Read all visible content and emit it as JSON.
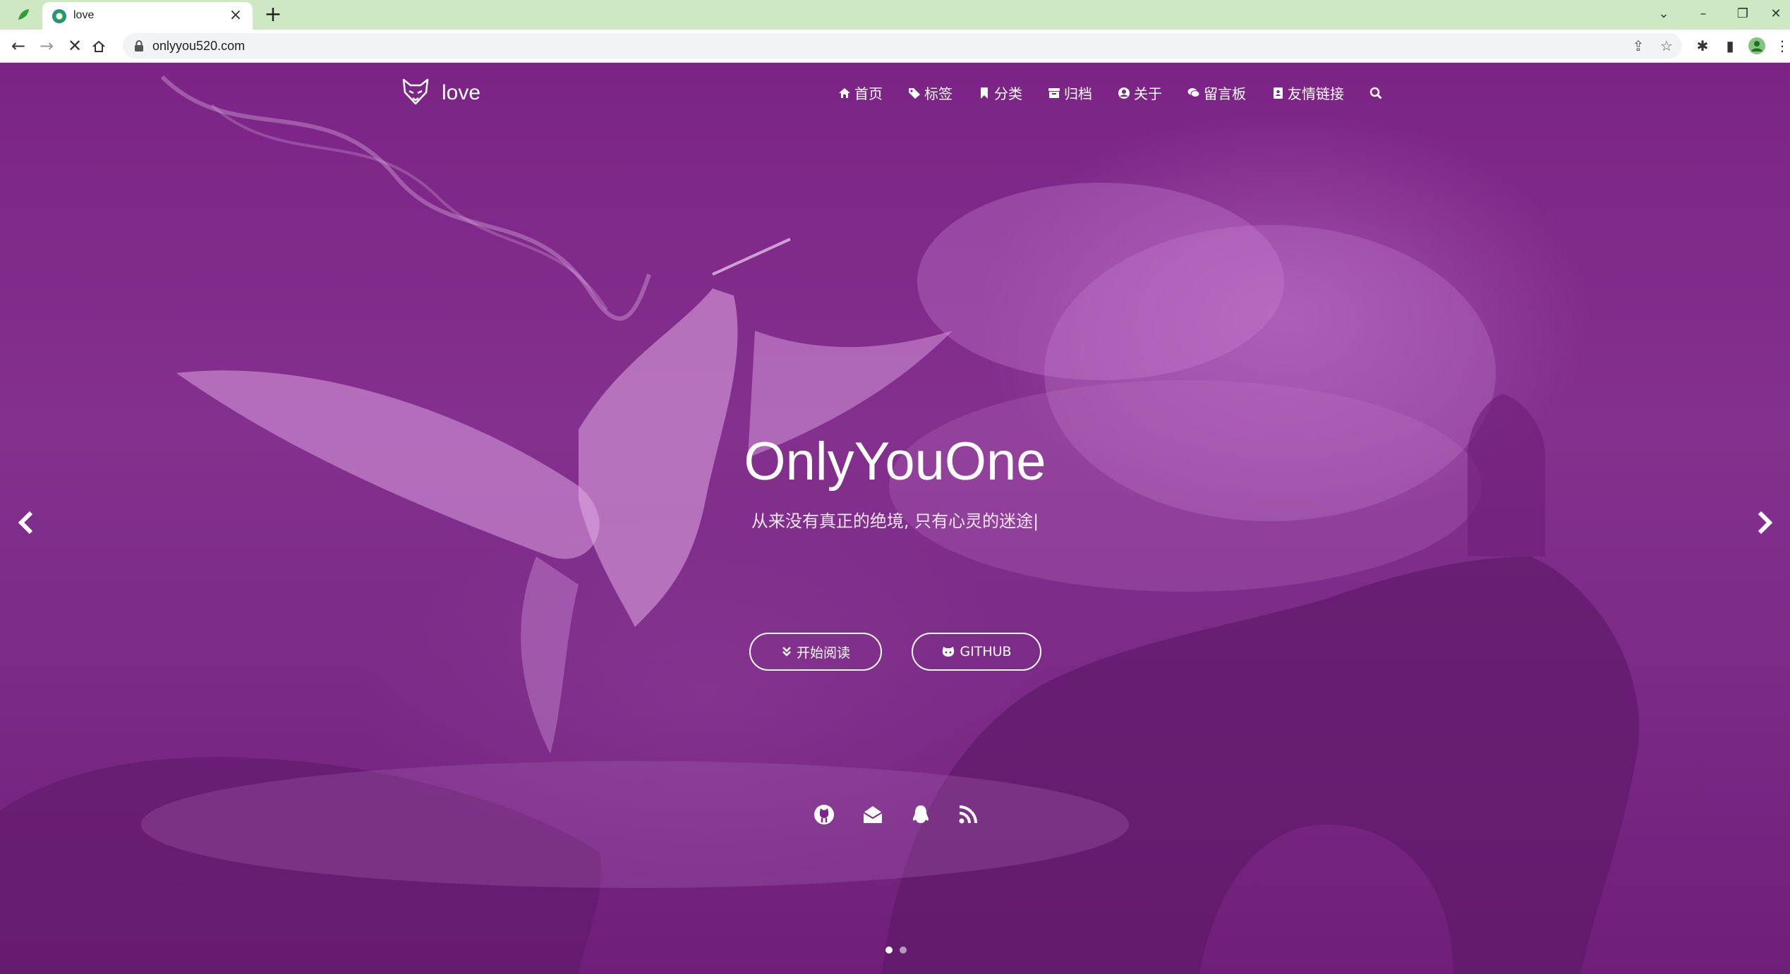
{
  "browser": {
    "tab_title": "love",
    "url": "onlyyou520.com"
  },
  "site": {
    "logo_text": "love",
    "nav": [
      {
        "icon": "home-icon",
        "label": "首页"
      },
      {
        "icon": "tags-icon",
        "label": "标签"
      },
      {
        "icon": "bookmark-icon",
        "label": "分类"
      },
      {
        "icon": "archive-icon",
        "label": "归档"
      },
      {
        "icon": "user-circle-icon",
        "label": "关于"
      },
      {
        "icon": "comments-icon",
        "label": "留言板"
      },
      {
        "icon": "address-book-icon",
        "label": "友情链接"
      }
    ]
  },
  "hero": {
    "title": "OnlyYouOne",
    "subtitle": "从来没有真正的绝境, 只有心灵的迷途|",
    "start_button": "开始阅读",
    "github_button": "GITHUB",
    "social_icons": [
      "github-icon",
      "envelope-icon",
      "qq-icon",
      "rss-icon"
    ],
    "carousel_slides": 2,
    "active_slide": 1
  },
  "colors": {
    "overlay": "#7a2383",
    "tabbar": "#cde8c2",
    "text": "#ffffff"
  }
}
